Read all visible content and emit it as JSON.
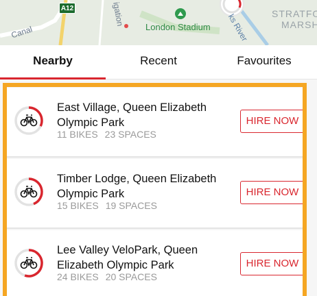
{
  "map": {
    "road_badge": "A12",
    "label_canal": "Canal",
    "label_navigation": "igation",
    "label_stadium": "London Stadium",
    "label_river": "ks River",
    "label_area_line1": "STRATFO",
    "label_area_line2": "MARSH"
  },
  "tabs": [
    {
      "label": "Nearby",
      "active": true
    },
    {
      "label": "Recent",
      "active": false
    },
    {
      "label": "Favourites",
      "active": false
    }
  ],
  "stations": [
    {
      "name": "East Village, Queen Elizabeth Olympic Park",
      "bikes": "11 BIKES",
      "spaces": "23 SPACES",
      "bike_fraction": 0.32,
      "action": "HIRE NOW"
    },
    {
      "name": "Timber Lodge, Queen Elizabeth Olympic Park",
      "bikes": "15 BIKES",
      "spaces": "19 SPACES",
      "bike_fraction": 0.44,
      "action": "HIRE NOW"
    },
    {
      "name": "Lee Valley VeloPark, Queen Elizabeth Olympic Park",
      "bikes": "24 BIKES",
      "spaces": "20 SPACES",
      "bike_fraction": 0.55,
      "action": "HIRE NOW"
    }
  ],
  "colors": {
    "accent": "#d9262e",
    "highlight": "#f5a623",
    "muted": "#9a9a9a"
  }
}
